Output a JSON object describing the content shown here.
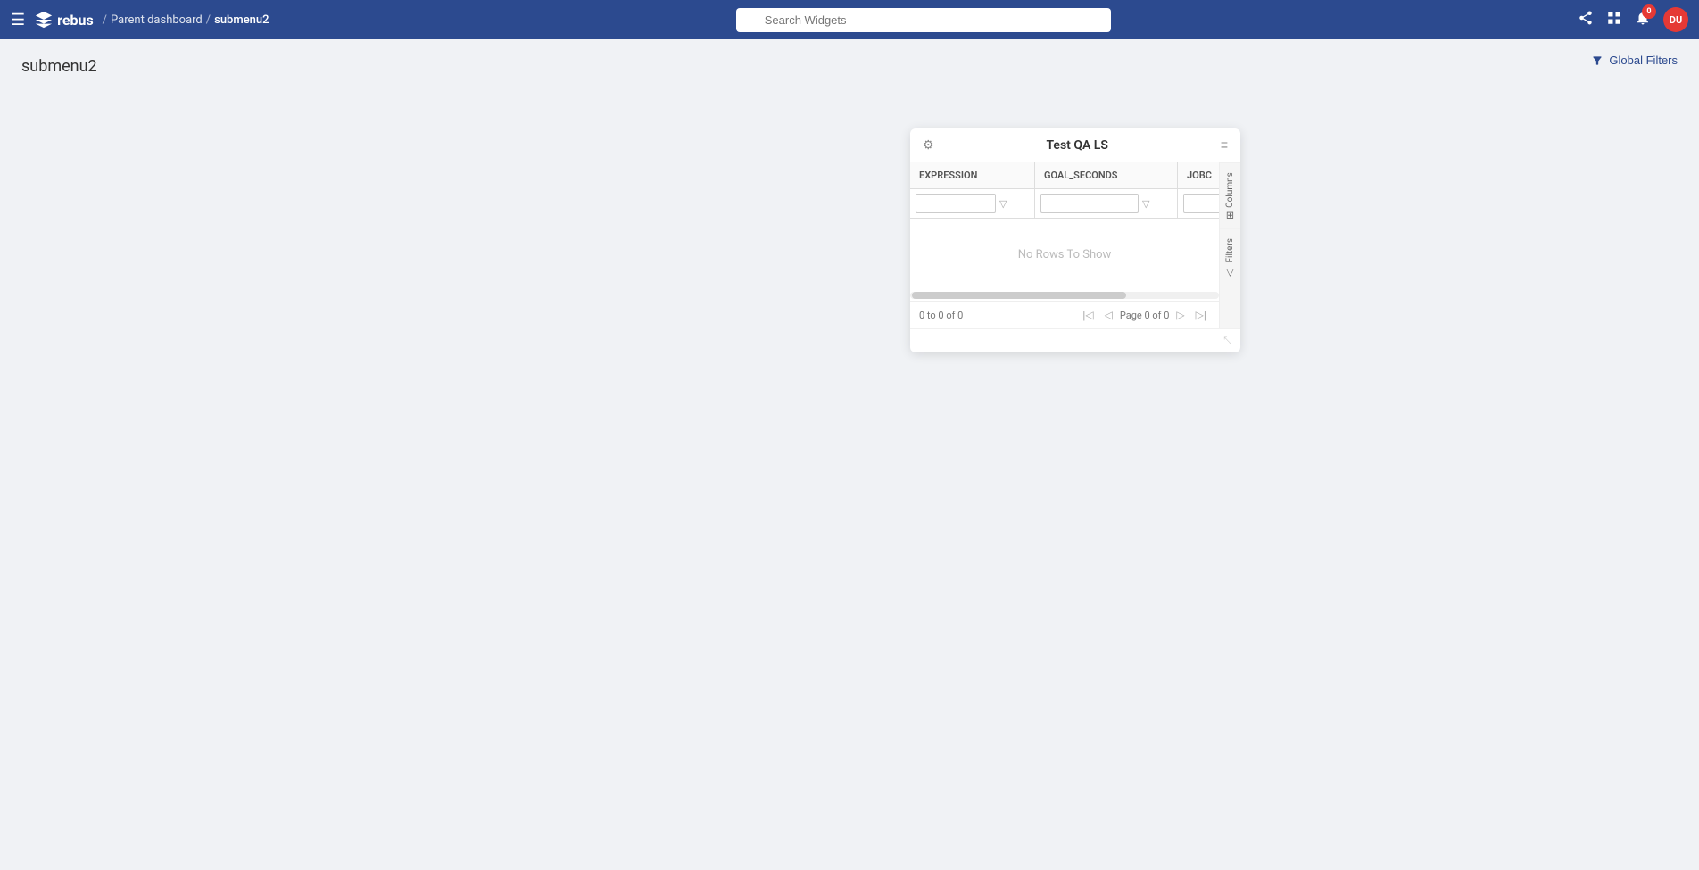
{
  "navbar": {
    "hamburger_label": "☰",
    "logo_text": "rebus",
    "breadcrumb": {
      "separator": "/",
      "parent": "Parent dashboard",
      "separator2": "/",
      "current": "submenu2"
    },
    "search_placeholder": "Search Widgets",
    "nav_icons": {
      "share": "share-icon",
      "grid": "grid-icon",
      "notification": "notification-icon",
      "notification_count": "0",
      "user_initials": "DU"
    }
  },
  "page": {
    "title": "submenu2",
    "global_filters_label": "Global Filters"
  },
  "widget": {
    "title": "Test QA LS",
    "columns": [
      {
        "id": "expression",
        "label": "Expression"
      },
      {
        "id": "goal_seconds",
        "label": "GOAL_SECONDS"
      },
      {
        "id": "job",
        "label": "JOBC"
      }
    ],
    "no_rows_text": "No Rows To Show",
    "pagination": {
      "count_text": "0 to 0 of 0",
      "page_text": "Page 0 of 0"
    },
    "side_tabs": [
      {
        "label": "Columns",
        "icon": "⊞"
      },
      {
        "label": "Filters",
        "icon": "▽"
      }
    ]
  }
}
